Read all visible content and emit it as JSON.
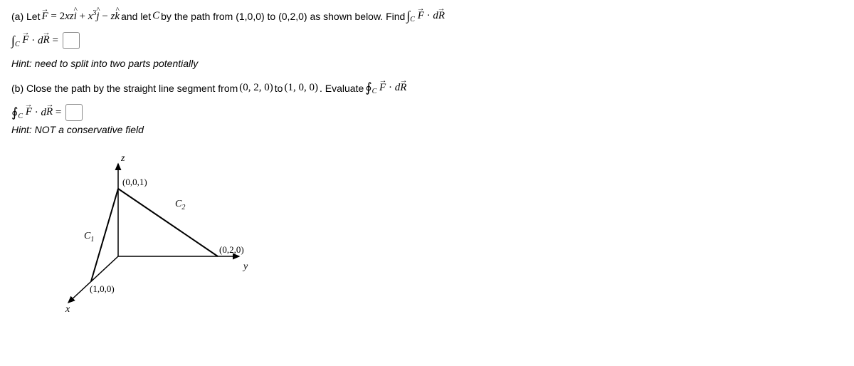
{
  "partA": {
    "label": "(a) Let ",
    "F": "F",
    "equals": " = 2",
    "xz": "xz",
    "ihat": "i",
    "plus1": " + ",
    "x": "x",
    "exp3": "3",
    "jhat": "j",
    "minus": " − ",
    "z": "z",
    "khat": "k",
    "rest1": " and let ",
    "C": "C",
    "rest2": " by the path from (1,0,0) to (0,2,0) as shown below. Find ",
    "int1": "∫",
    "Csub1": "C",
    "Fvec1": "F",
    "dot1": " · ",
    "d1": "d",
    "Rvec1": "R"
  },
  "eqA": {
    "int": "∫",
    "Csub": "C",
    "F": "F",
    "dot": " · ",
    "d": "d",
    "R": "R",
    "eq": " = "
  },
  "hintA": "Hint: need to split into two parts potentially",
  "partB": {
    "label": "(b) Close the path by the straight line segment from ",
    "p1": "(0, 2, 0)",
    "to": " to ",
    "p2": "(1, 0, 0)",
    "rest": ". Evaluate ",
    "int": "∮",
    "Csub": "C",
    "F": "F",
    "dot": " · ",
    "d": "d",
    "R": "R"
  },
  "eqB": {
    "int": "∮",
    "Csub": "C",
    "F": "F",
    "dot": " · ",
    "d": "d",
    "R": "R",
    "eq": " = "
  },
  "hintB": "Hint: NOT a conservative field",
  "figure": {
    "z": "z",
    "x": "x",
    "y": "y",
    "p001": "(0,0,1)",
    "p100": "(1,0,0)",
    "p020": "(0,2,0)",
    "C1": "C",
    "C1sub": "1",
    "C2": "C",
    "C2sub": "2"
  }
}
